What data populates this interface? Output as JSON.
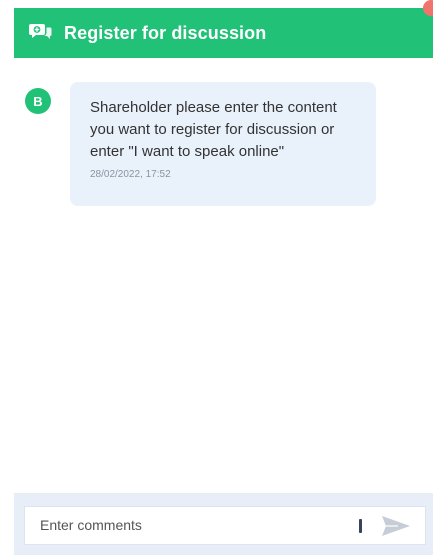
{
  "header": {
    "title": "Register for discussion",
    "icon": "chat-add-icon",
    "accent_color": "#21c178"
  },
  "messages": [
    {
      "avatar_initial": "B",
      "text": "Shareholder please enter the content you want to register for discussion or enter \"I want to speak online\"",
      "timestamp": "28/02/2022, 17:52"
    }
  ],
  "composer": {
    "placeholder": "Enter comments",
    "value": "",
    "send_icon": "send-icon"
  }
}
